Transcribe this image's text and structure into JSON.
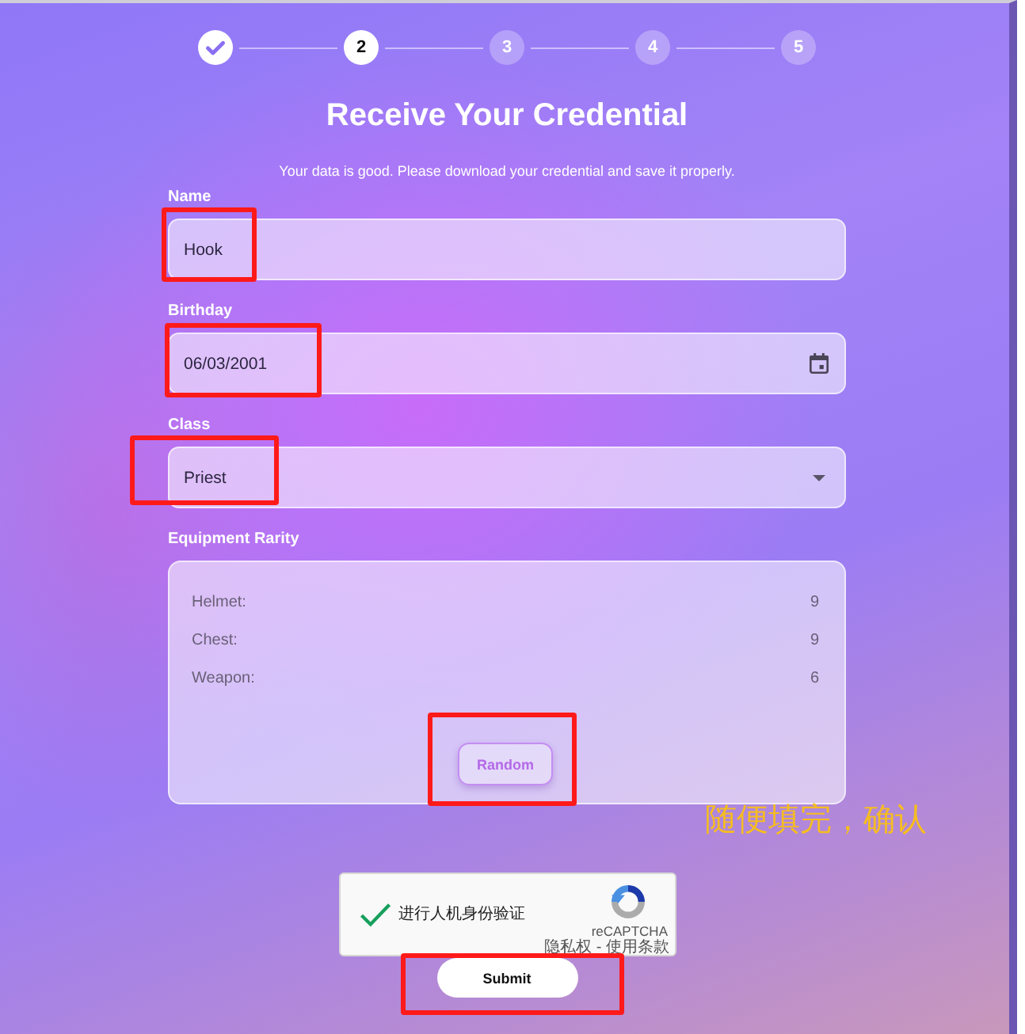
{
  "steps": [
    {
      "completed": true,
      "selected": false
    },
    {
      "label": "2",
      "completed": false,
      "selected": true
    },
    {
      "label": "3",
      "completed": false,
      "selected": false
    },
    {
      "label": "4",
      "completed": false,
      "selected": false
    },
    {
      "label": "5",
      "completed": false,
      "selected": false
    }
  ],
  "title": "Receive Your Credential",
  "subtitle": "Your data is good. Please download your credential and save it properly.",
  "fields": [
    {
      "label": "Name",
      "kind": "text",
      "value": "Hook",
      "highlighted": true
    },
    {
      "label": "Birthday",
      "kind": "date",
      "value": "06/03/2001",
      "highlighted": true
    },
    {
      "label": "Class",
      "kind": "select",
      "value": "Priest",
      "highlighted": true
    }
  ],
  "equipment": {
    "label": "Equipment Rarity",
    "rows": [
      {
        "name": "Helmet:",
        "value": "9"
      },
      {
        "name": "Chest:",
        "value": "9"
      },
      {
        "name": "Weapon:",
        "value": "6"
      }
    ],
    "button": {
      "label": "Random",
      "highlighted": true
    }
  },
  "annotation": "随便填完，确认",
  "captcha": {
    "checked": true,
    "text": "进行人机身份验证",
    "brand": "reCAPTCHA",
    "links": "隐私权 - 使用条款"
  },
  "submit": {
    "label": "Submit",
    "highlighted": true
  }
}
